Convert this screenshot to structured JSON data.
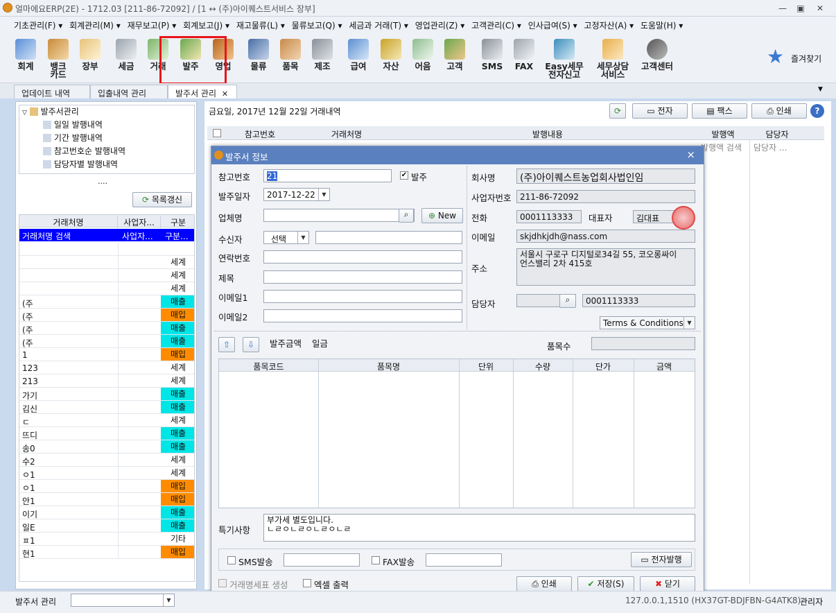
{
  "window": {
    "title": "얼마에요ERP(2E) - 1712.03 [211-86-72092] / [1 ↔ (주)아이퀘스트서비스 장부]",
    "min": "—",
    "restore": "▣",
    "close": "✕"
  },
  "menu": [
    "기초관리(F) ▾",
    "회계관리(M) ▾",
    "재무보고(P) ▾",
    "회계보고(J) ▾",
    "재고물류(L) ▾",
    "물류보고(Q) ▾",
    "세금과 거래(T) ▾",
    "영업관리(Z) ▾",
    "고객관리(C) ▾",
    "인사급여(S) ▾",
    "고정자산(A) ▾",
    "도움말(H) ▾"
  ],
  "toolbar": {
    "items": [
      {
        "id": "회계",
        "label": "회계"
      },
      {
        "id": "bank",
        "label": "뱅크\n카드"
      },
      {
        "id": "ledger",
        "label": "장부"
      },
      {
        "id": "tax",
        "label": "세금"
      },
      {
        "id": "trade",
        "label": "거래"
      },
      {
        "id": "order",
        "label": "발주"
      },
      {
        "id": "sales",
        "label": "영업"
      },
      {
        "id": "logistics",
        "label": "물류"
      },
      {
        "id": "items",
        "label": "품목"
      },
      {
        "id": "make",
        "label": "제조"
      },
      {
        "id": "pay",
        "label": "급여"
      },
      {
        "id": "asset",
        "label": "자산"
      },
      {
        "id": "bill",
        "label": "어음"
      },
      {
        "id": "customer",
        "label": "고객"
      },
      {
        "id": "sms",
        "label": "SMS"
      },
      {
        "id": "fax",
        "label": "FAX"
      },
      {
        "id": "easytax",
        "label": "Easy세무\n전자신고"
      },
      {
        "id": "taxconsult",
        "label": "세무상담\n서비스"
      },
      {
        "id": "callcenter",
        "label": "고객센터"
      }
    ],
    "favorites": "즐겨찾기"
  },
  "tabs": [
    {
      "label": "업데이트 내역"
    },
    {
      "label": "입출내역 관리"
    },
    {
      "label": "발주서 관리"
    }
  ],
  "tab_close": "✕",
  "tree": {
    "root": "발주서관리",
    "children": [
      "일일 발행내역",
      "기간 발행내역",
      "참고번호순 발행내역",
      "담당자별 발행내역"
    ],
    "more": "...."
  },
  "refresh_list": "목록갱신",
  "left_grid": {
    "headers": [
      "거래처명",
      "사업자...",
      "구분"
    ],
    "search_row": [
      "거래처명 검색",
      "사업자...",
      "구분..."
    ],
    "rows": [
      [
        "",
        ""
      ],
      [
        "",
        "세계"
      ],
      [
        "",
        "세계"
      ],
      [
        "",
        "세계"
      ],
      [
        "(주",
        "매출"
      ],
      [
        "(주",
        "매입"
      ],
      [
        "(주",
        "매출"
      ],
      [
        "(주",
        "매출"
      ],
      [
        "1",
        "매입"
      ],
      [
        "123",
        "세계"
      ],
      [
        "213",
        "세계"
      ],
      [
        "가기",
        "매출"
      ],
      [
        "김신",
        "매출"
      ],
      [
        "ㄷ",
        "세계"
      ],
      [
        "뜨디",
        "매출"
      ],
      [
        "송0",
        "매출"
      ],
      [
        "수2",
        "세계"
      ],
      [
        "ㅇ1",
        "세계"
      ],
      [
        "ㅇ1",
        "매입"
      ],
      [
        "안1",
        "매입"
      ],
      [
        "이기",
        "매출"
      ],
      [
        "일E",
        "매출"
      ],
      [
        "ㅍ1",
        "기타"
      ],
      [
        "현1",
        "매입"
      ]
    ]
  },
  "main": {
    "date_title": "금요일, 2017년 12월 22일 거래내역",
    "buttons": [
      "전자",
      "팩스",
      "인쇄"
    ],
    "help": "?",
    "grid_headers": [
      "참고번호",
      "거래처명",
      "발행내용",
      "발행액",
      "담당자"
    ],
    "filter_row": [
      "발행액 검색",
      "담당자 ..."
    ]
  },
  "dialog": {
    "title": "발주서 정보",
    "close": "×",
    "ref_no_label": "참고번호",
    "ref_no": "21",
    "order_check": "발주",
    "order_checked": "✔",
    "date_label": "발주일자",
    "date": "2017-12-22",
    "company_label": "업체명",
    "company": "",
    "new_btn": "New",
    "receiver_label": "수신자",
    "receiver_sel": "선택",
    "receiver": "",
    "contact_label": "연락번호",
    "subject_label": "제목",
    "email1_label": "이메일1",
    "email2_label": "이메일2",
    "cname_label": "회사명",
    "cname": "(주)아이퀘스트농업회사법인임",
    "bizno_label": "사업자번호",
    "bizno": "211-86-72092",
    "phone_label": "전화",
    "phone": "0001113333",
    "ceo_label": "대표자",
    "ceo": "김대표",
    "email_label": "이메일",
    "email": "skjdhkjdh@nass.com",
    "addr_label": "주소",
    "addr": "서울시 구로구 디지털로34길 55, 코오롱싸이언스밸리 2차 415호",
    "manager_label": "담당자",
    "manager_phone": "0001113333",
    "terms": "Terms & Conditions",
    "amount_label": "발주금액",
    "amount_text": "일금",
    "count_label": "품목수",
    "grid_headers": [
      "품목코드",
      "품목명",
      "단위",
      "수량",
      "단가",
      "금액"
    ],
    "remark_label": "특기사항",
    "remark_line1": "부가세 별도입니다.",
    "remark_line2": "ㄴㄹㅇㄴㄹㅇㄴㄹㅇㄴㄹ",
    "sms_label": "SMS발송",
    "fax_label": "FAX발송",
    "einvoice_btn": "전자발행",
    "stmt_label": "거래명세표 생성",
    "excel_label": "엑셀 출력",
    "print_btn": "인쇄",
    "save_btn": "저장(S)",
    "close_btn": "닫기"
  },
  "status": {
    "left": "발주서 관리",
    "right_info": "127.0.0.1,1510 (HX37GT-BDJFBN-G4ATK8)",
    "user": "관리자"
  },
  "colors": {
    "sale": "#00e5e5",
    "buy": "#ff8c00",
    "highlight": "#0000ff",
    "accent": "#5b80bf"
  }
}
